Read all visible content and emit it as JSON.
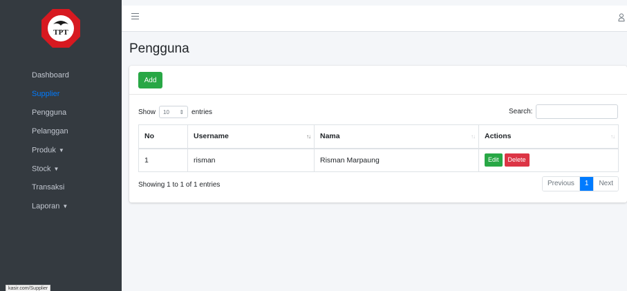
{
  "sidebar": {
    "items": [
      {
        "label": "Dashboard",
        "active": false,
        "dropdown": false
      },
      {
        "label": "Supplier",
        "active": true,
        "dropdown": false
      },
      {
        "label": "Pengguna",
        "active": false,
        "dropdown": false
      },
      {
        "label": "Pelanggan",
        "active": false,
        "dropdown": false
      },
      {
        "label": "Produk",
        "active": false,
        "dropdown": true
      },
      {
        "label": "Stock",
        "active": false,
        "dropdown": true
      },
      {
        "label": "Transaksi",
        "active": false,
        "dropdown": false
      },
      {
        "label": "Laporan",
        "active": false,
        "dropdown": true
      }
    ],
    "logo_text": "TPT",
    "status_url": "kasir.com/Supplier"
  },
  "header": {
    "menu_icon": "hamburger-icon",
    "user_icon": "user-icon"
  },
  "page": {
    "title": "Pengguna"
  },
  "card": {
    "add_label": "Add",
    "show_label": "Show",
    "entries_label": "entries",
    "page_length": "10",
    "search_label": "Search:",
    "search_value": ""
  },
  "table": {
    "columns": [
      "No",
      "Username",
      "Nama",
      "Actions"
    ],
    "rows": [
      {
        "no": "1",
        "username": "risman",
        "nama": "Risman Marpaung",
        "edit": "Edit",
        "delete": "Delete"
      }
    ]
  },
  "footer": {
    "info": "Showing 1 to 1 of 1 entries",
    "previous": "Previous",
    "current_page": "1",
    "next": "Next"
  },
  "colors": {
    "sidebar": "#343a40",
    "active": "#007bff",
    "success": "#28a745",
    "danger": "#dc3545"
  }
}
